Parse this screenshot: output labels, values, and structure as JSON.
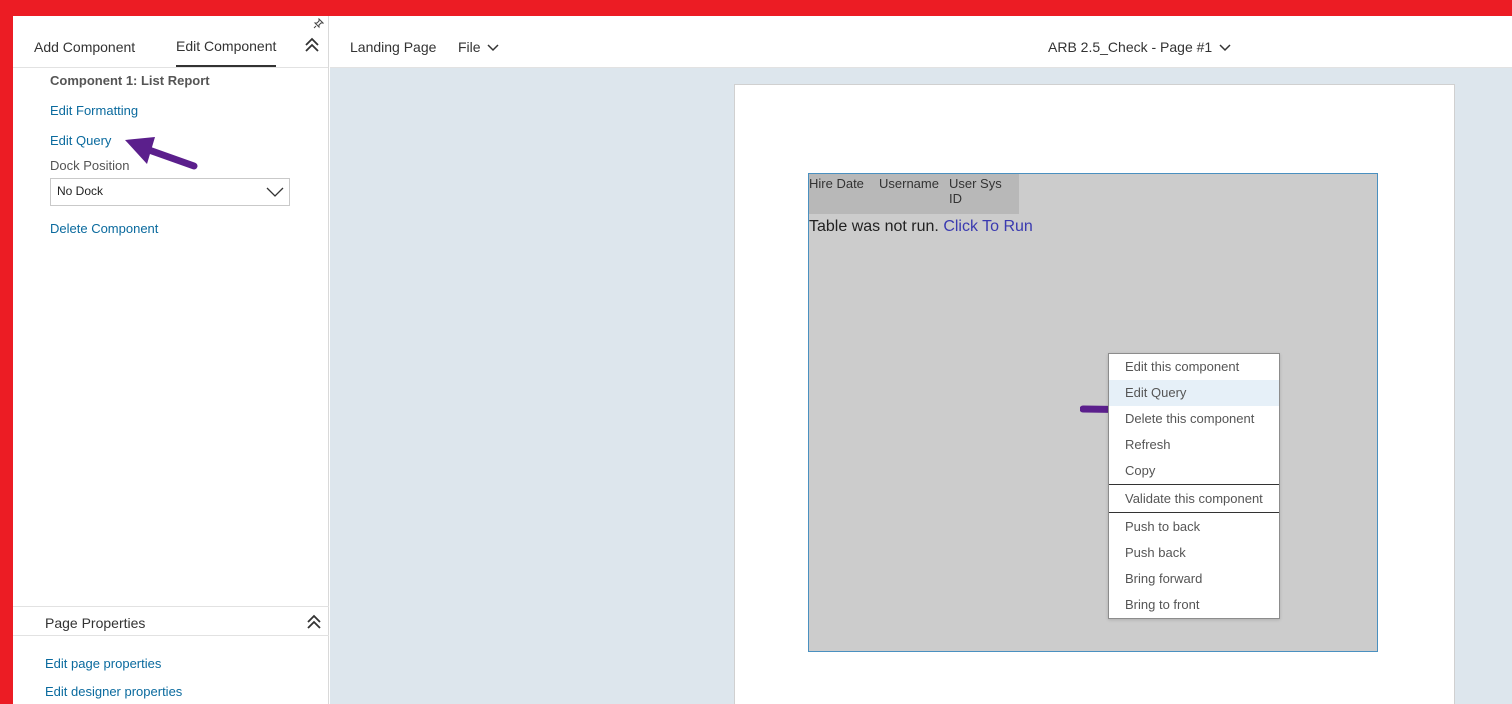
{
  "left_panel": {
    "tabs": {
      "add": "Add Component",
      "edit": "Edit Component"
    },
    "component_title": "Component 1: List Report",
    "edit_formatting": "Edit Formatting",
    "edit_query": "Edit Query",
    "dock_label": "Dock Position",
    "dock_value": "No Dock",
    "delete": "Delete Component",
    "page_properties": {
      "title": "Page Properties",
      "edit_page": "Edit page properties",
      "edit_designer": "Edit designer properties"
    }
  },
  "topbar": {
    "landing": "Landing Page",
    "file": "File",
    "page_title": "ARB 2.5_Check - Page #1"
  },
  "table": {
    "columns": [
      "Hire Date",
      "Username",
      "User Sys ID"
    ],
    "message": "Table was not run.",
    "run_link": "Click To Run"
  },
  "context_menu": {
    "items": [
      "Edit this component",
      "Edit Query",
      "Delete this component",
      "Refresh",
      "Copy"
    ],
    "validate": "Validate this component",
    "arrange": [
      "Push to back",
      "Push back",
      "Bring forward",
      "Bring to front"
    ]
  },
  "colors": {
    "frame": "#ec1c24",
    "link": "#0a6a9e",
    "arrow": "#5b1f8c",
    "canvas": "#dde6ed"
  },
  "icons": [
    "pin-icon",
    "double-chevron-up-icon",
    "chevron-down-icon",
    "annotation-arrow"
  ]
}
